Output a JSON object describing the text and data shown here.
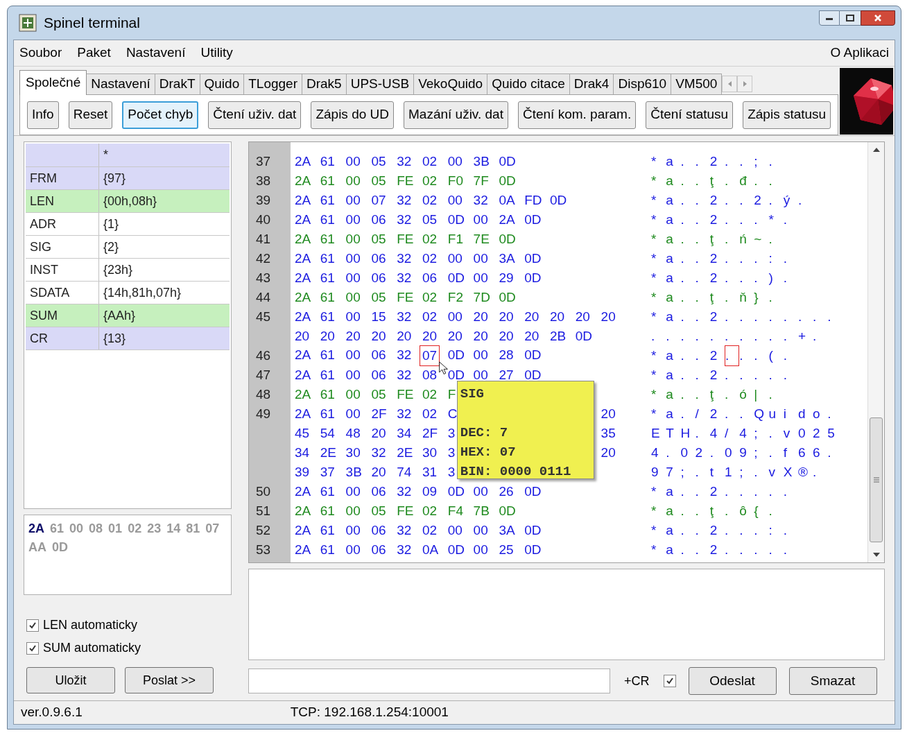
{
  "window": {
    "title": "Spinel terminal"
  },
  "menu": {
    "items": [
      "Soubor",
      "Paket",
      "Nastavení",
      "Utility"
    ],
    "right": "O Aplikaci"
  },
  "tabs": [
    {
      "label": "Společné",
      "selected": true
    },
    {
      "label": "Nastavení",
      "selected": false
    },
    {
      "label": "DrakT",
      "selected": false
    },
    {
      "label": "Quido",
      "selected": false
    },
    {
      "label": "TLogger",
      "selected": false
    },
    {
      "label": "Drak5",
      "selected": false
    },
    {
      "label": "UPS-USB",
      "selected": false
    },
    {
      "label": "VekoQuido",
      "selected": false
    },
    {
      "label": "Quido citace",
      "selected": false
    },
    {
      "label": "Drak4",
      "selected": false
    },
    {
      "label": "Disp610",
      "selected": false
    },
    {
      "label": "VM500",
      "selected": false
    }
  ],
  "toolbar_buttons": [
    {
      "label": "Info",
      "focused": false
    },
    {
      "label": "Reset",
      "focused": false
    },
    {
      "label": "Počet chyb",
      "focused": true
    },
    {
      "label": "Čtení uživ. dat",
      "focused": false
    },
    {
      "label": "Zápis do UD",
      "focused": false
    },
    {
      "label": "Mazání uživ. dat",
      "focused": false
    },
    {
      "label": "Čtení kom. param.",
      "focused": false
    },
    {
      "label": "Čtení statusu",
      "focused": false
    },
    {
      "label": "Zápis statusu",
      "focused": false
    }
  ],
  "frame_table": {
    "header_value": "*",
    "rows": [
      {
        "field": "FRM",
        "value": "{97}",
        "color": "#d9d9f7"
      },
      {
        "field": "LEN",
        "value": "{00h,08h}",
        "color": "#c6f0be"
      },
      {
        "field": "ADR",
        "value": "{1}",
        "color": "#ffffff"
      },
      {
        "field": "SIG",
        "value": "{2}",
        "color": "#ffffff"
      },
      {
        "field": "INST",
        "value": "{23h}",
        "color": "#ffffff"
      },
      {
        "field": "SDATA",
        "value": "{14h,81h,07h}",
        "color": "#ffffff"
      },
      {
        "field": "SUM",
        "value": "{AAh}",
        "color": "#c6f0be"
      },
      {
        "field": "CR",
        "value": "{13}",
        "color": "#d9d9f7"
      }
    ]
  },
  "preview": [
    {
      "text": "2A",
      "current": true
    },
    {
      "text": "61",
      "current": false
    },
    {
      "text": "00",
      "current": false
    },
    {
      "text": "08",
      "current": false
    },
    {
      "text": "01",
      "current": false
    },
    {
      "text": "02",
      "current": false
    },
    {
      "text": "23",
      "current": false
    },
    {
      "text": "14",
      "current": false
    },
    {
      "text": "81",
      "current": false
    },
    {
      "text": "07",
      "current": false
    },
    {
      "text": "AA",
      "current": false
    },
    {
      "text": "0D",
      "current": false
    }
  ],
  "options": [
    {
      "label": "LEN automaticky",
      "checked": true
    },
    {
      "label": "SUM automaticky",
      "checked": true
    }
  ],
  "left_buttons": [
    "Uložit",
    "Poslat >>"
  ],
  "log": {
    "rows": [
      {
        "num": "37",
        "kind": "tx",
        "bytes": [
          "2A",
          "61",
          "00",
          "05",
          "32",
          "02",
          "00",
          "3B",
          "0D"
        ],
        "ascii": [
          "* a . . 2 . . ; ."
        ]
      },
      {
        "num": "38",
        "kind": "rx",
        "bytes": [
          "2A",
          "61",
          "00",
          "05",
          "FE",
          "02",
          "F0",
          "7F",
          "0D"
        ],
        "ascii": [
          "* a . . ţ . đ . ."
        ]
      },
      {
        "num": "39",
        "kind": "tx",
        "bytes": [
          "2A",
          "61",
          "00",
          "07",
          "32",
          "02",
          "00",
          "32",
          "0A",
          "FD",
          "0D"
        ],
        "ascii": [
          "* a . . 2 . . 2 . ý ."
        ]
      },
      {
        "num": "40",
        "kind": "tx",
        "bytes": [
          "2A",
          "61",
          "00",
          "06",
          "32",
          "05",
          "0D",
          "00",
          "2A",
          "0D"
        ],
        "ascii": [
          "* a . . 2 . . . * ."
        ]
      },
      {
        "num": "41",
        "kind": "rx",
        "bytes": [
          "2A",
          "61",
          "00",
          "05",
          "FE",
          "02",
          "F1",
          "7E",
          "0D"
        ],
        "ascii": [
          "* a . . ţ . ń ~ ."
        ]
      },
      {
        "num": "42",
        "kind": "tx",
        "bytes": [
          "2A",
          "61",
          "00",
          "06",
          "32",
          "02",
          "00",
          "00",
          "3A",
          "0D"
        ],
        "ascii": [
          "* a . . 2 . . . : ."
        ]
      },
      {
        "num": "43",
        "kind": "tx",
        "bytes": [
          "2A",
          "61",
          "00",
          "06",
          "32",
          "06",
          "0D",
          "00",
          "29",
          "0D"
        ],
        "ascii": [
          "* a . . 2 . . . ) ."
        ]
      },
      {
        "num": "44",
        "kind": "rx",
        "bytes": [
          "2A",
          "61",
          "00",
          "05",
          "FE",
          "02",
          "F2",
          "7D",
          "0D"
        ],
        "ascii": [
          "* a . . ţ . ň } ."
        ]
      },
      {
        "num": "45",
        "kind": "tx",
        "bytes": [
          "2A",
          "61",
          "00",
          "15",
          "32",
          "02",
          "00",
          "20",
          "20",
          "20",
          "20",
          "20",
          "20"
        ],
        "ascii": [
          "* a . . 2 . . . . . . . ."
        ]
      },
      {
        "kind": "tx",
        "bytes": [
          "20",
          "20",
          "20",
          "20",
          "20",
          "20",
          "20",
          "20",
          "20",
          "20",
          "2B",
          "0D"
        ],
        "ascii": [
          ". . . . . . . . . . + ."
        ]
      },
      {
        "num": "46",
        "kind": "tx",
        "bytes": [
          "2A",
          "61",
          "00",
          "06",
          "32",
          {
            "text": "07",
            "marked": true
          },
          "0D",
          "00",
          "28",
          "0D"
        ],
        "ascii": [
          "* a . . 2",
          {
            "text": ".",
            "marked": true
          },
          ". . ( ."
        ]
      },
      {
        "num": "47",
        "kind": "tx",
        "bytes": [
          "2A",
          "61",
          "00",
          "06",
          "32",
          "08",
          "0D",
          "00",
          "27",
          "0D"
        ],
        "ascii": [
          "* a . . 2 . . . . ."
        ]
      },
      {
        "num": "48",
        "kind": "rx",
        "bytes": [
          "2A",
          "61",
          "00",
          "05",
          "FE",
          "02",
          "F"
        ],
        "ascii": [
          "* a . . ţ . ó | ."
        ]
      },
      {
        "num": "49",
        "kind": "tx",
        "bytes": [
          "2A",
          "61",
          "00",
          "2F",
          "32",
          "02",
          "C"
        ],
        "bytes_after": [
          "20"
        ],
        "ascii": [
          "* a . / 2 . . Q u i d o ."
        ]
      },
      {
        "kind": "tx",
        "bytes": [
          "45",
          "54",
          "48",
          "20",
          "34",
          "2F",
          "3"
        ],
        "bytes_after": [
          "35"
        ],
        "ascii": [
          "E T H . 4 / 4 ; . v 0 2 5"
        ]
      },
      {
        "kind": "tx",
        "bytes": [
          "34",
          "2E",
          "30",
          "32",
          "2E",
          "30",
          "3"
        ],
        "bytes_after": [
          "20"
        ],
        "ascii": [
          "4 . 0 2 . 0 9 ; . f 6 6 ."
        ]
      },
      {
        "kind": "tx",
        "bytes": [
          "39",
          "37",
          "3B",
          "20",
          "74",
          "31",
          "3"
        ],
        "ascii": [
          "9 7 ; . t 1 ; . v X ® ."
        ]
      },
      {
        "num": "50",
        "kind": "tx",
        "bytes": [
          "2A",
          "61",
          "00",
          "06",
          "32",
          "09",
          "0D",
          "00",
          "26",
          "0D"
        ],
        "ascii": [
          "* a . . 2 . . . . ."
        ]
      },
      {
        "num": "51",
        "kind": "rx",
        "bytes": [
          "2A",
          "61",
          "00",
          "05",
          "FE",
          "02",
          "F4",
          "7B",
          "0D"
        ],
        "ascii": [
          "* a . . ţ . ô { ."
        ]
      },
      {
        "num": "52",
        "kind": "tx",
        "bytes": [
          "2A",
          "61",
          "00",
          "06",
          "32",
          "02",
          "00",
          "00",
          "3A",
          "0D"
        ],
        "ascii": [
          "* a . . 2 . . . : ."
        ]
      },
      {
        "num": "53",
        "kind": "tx",
        "bytes": [
          "2A",
          "61",
          "00",
          "06",
          "32",
          "0A",
          "0D",
          "00",
          "25",
          "0D"
        ],
        "ascii": [
          "* a . . 2 . . . . ."
        ]
      }
    ]
  },
  "tooltip": {
    "title": "SIG",
    "lines": [
      "DEC: 7",
      "HEX: 07",
      "BIN: 0000 0111"
    ]
  },
  "send_bar": {
    "cr_label": "+CR",
    "append_cr": true,
    "buttons": [
      "Odeslat",
      "Smazat"
    ]
  },
  "status_bar": [
    "ver.0.9.6.1",
    "TCP: 192.168.1.254:10001"
  ]
}
